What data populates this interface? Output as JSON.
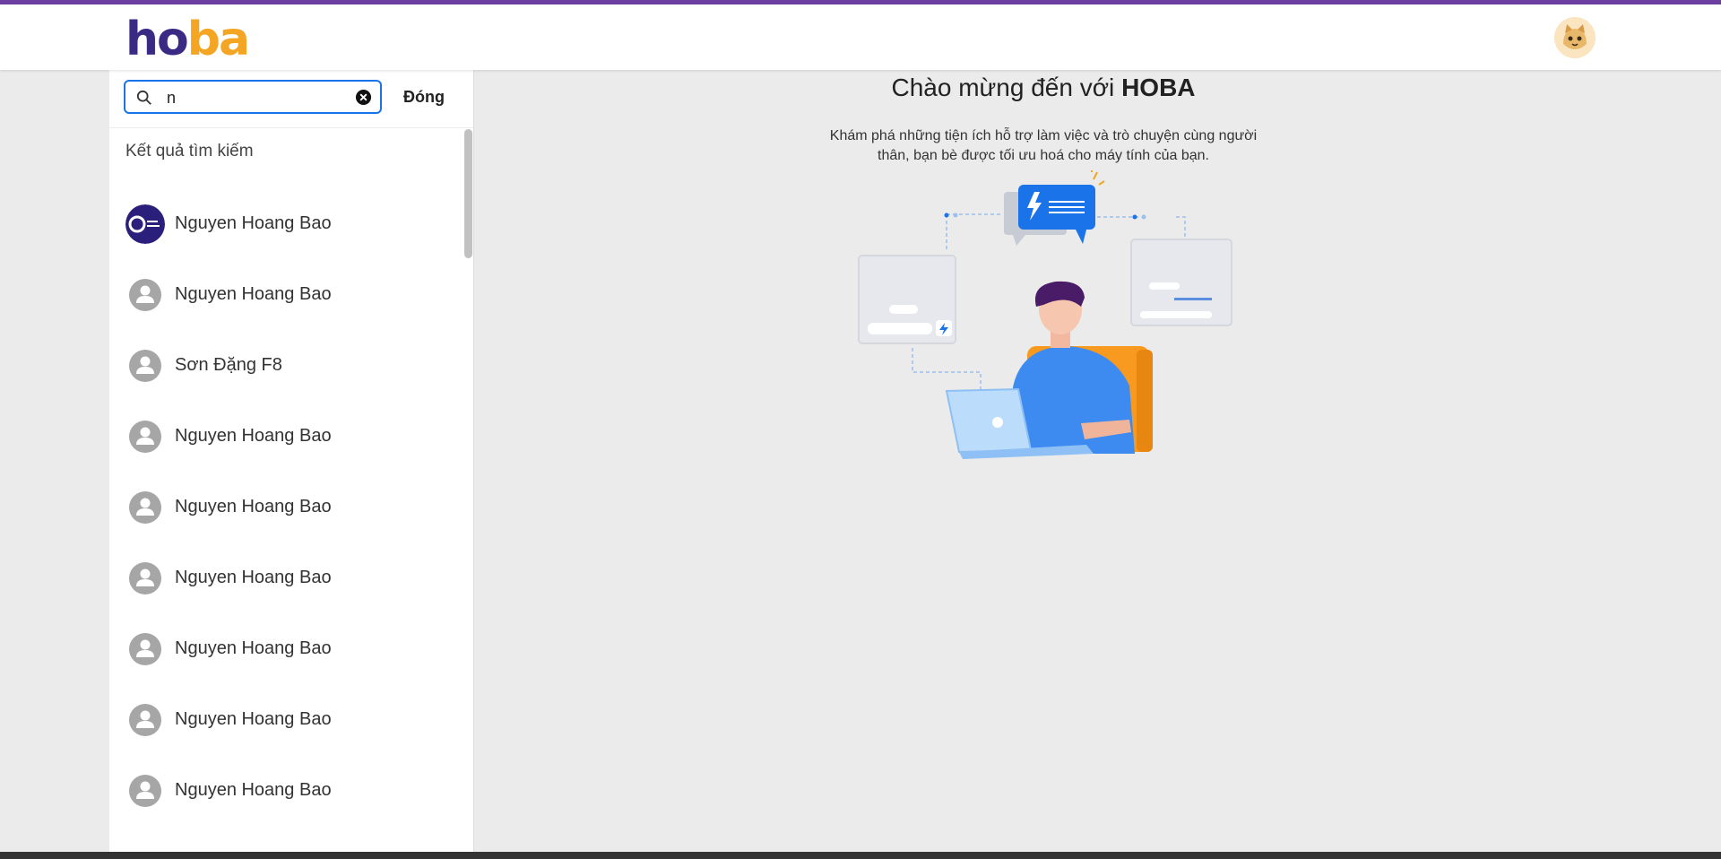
{
  "app": {
    "logo_left": "ho",
    "logo_right": "ba"
  },
  "colors": {
    "brand_purple": "#3b2a84",
    "brand_orange": "#f4a523",
    "accent_blue": "#1a73e8"
  },
  "search": {
    "value": "n",
    "placeholder": "",
    "close_label": "Đóng"
  },
  "results": {
    "title": "Kết quả tìm kiếm",
    "items": [
      {
        "name": "Nguyen Hoang Bao",
        "avatar": "brand-logo-avatar"
      },
      {
        "name": "Nguyen Hoang Bao",
        "avatar": "default-user-icon"
      },
      {
        "name": "Sơn Đặng F8",
        "avatar": "default-user-icon"
      },
      {
        "name": "Nguyen Hoang Bao",
        "avatar": "default-user-icon"
      },
      {
        "name": "Nguyen Hoang Bao",
        "avatar": "default-user-icon"
      },
      {
        "name": "Nguyen Hoang Bao",
        "avatar": "default-user-icon"
      },
      {
        "name": "Nguyen Hoang Bao",
        "avatar": "default-user-icon"
      },
      {
        "name": "Nguyen Hoang Bao",
        "avatar": "default-user-icon"
      },
      {
        "name": "Nguyen Hoang Bao",
        "avatar": "default-user-icon"
      }
    ]
  },
  "welcome": {
    "title_prefix": "Chào mừng đến với",
    "title_brand": "HOBA",
    "description": "Khám phá những tiện ích hỗ trợ làm việc và trò chuyện cùng người thân, bạn bè được tối ưu hoá cho máy tính của bạn."
  }
}
